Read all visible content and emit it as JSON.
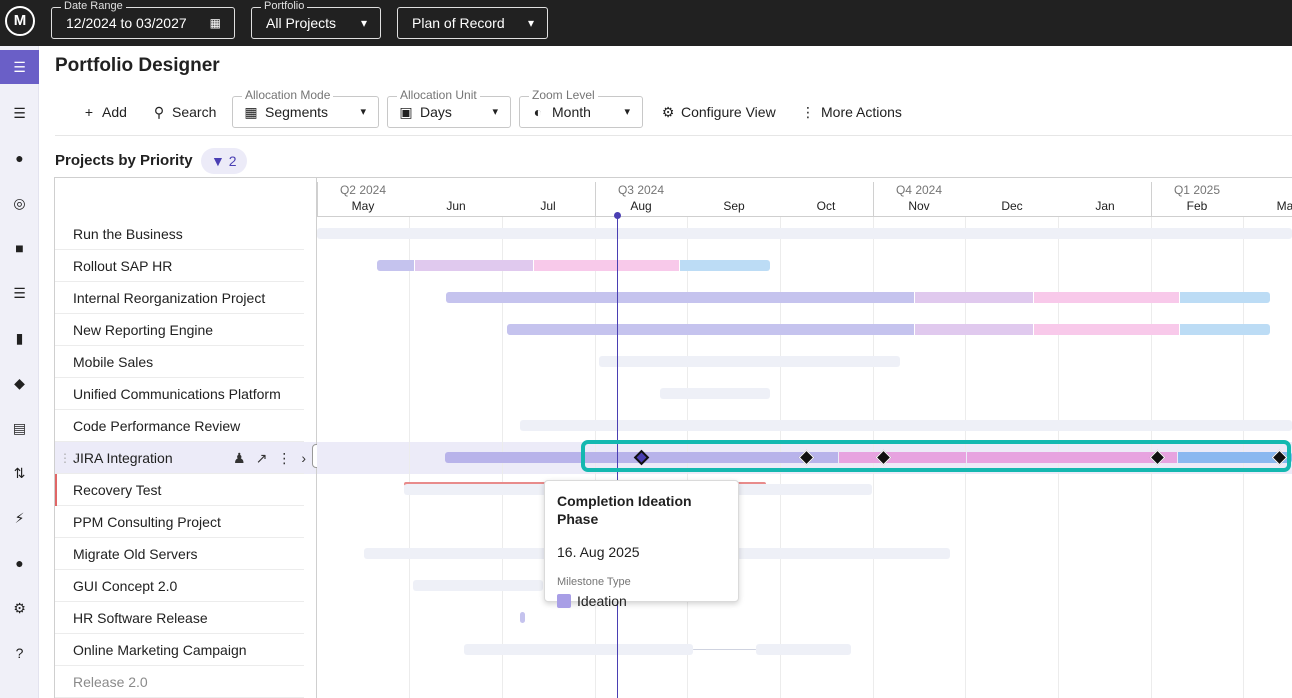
{
  "topbar": {
    "logo": "M",
    "date_range": {
      "legend": "Date Range",
      "value": "12/2024 to 03/2027",
      "icon": "calendar-icon"
    },
    "portfolio": {
      "legend": "Portfolio",
      "value": "All Projects"
    },
    "scenario": {
      "value": "Plan of Record"
    }
  },
  "sidebar": {
    "items": [
      "menu-icon",
      "resources-icon",
      "portfolio-icon",
      "goals-icon",
      "tasks-icon",
      "list-icon",
      "board-icon",
      "roadmap-icon",
      "document-icon",
      "transfer-icon",
      "plugin-icon",
      "users-icon",
      "settings-icon",
      "help-icon"
    ]
  },
  "page": {
    "title": "Portfolio Designer"
  },
  "toolbar": {
    "add": "Add",
    "search": "Search",
    "allocation_mode": {
      "legend": "Allocation Mode",
      "value": "Segments"
    },
    "allocation_unit": {
      "legend": "Allocation Unit",
      "value": "Days"
    },
    "zoom_level": {
      "legend": "Zoom Level",
      "value": "Month"
    },
    "configure_view": "Configure View",
    "more_actions": "More Actions"
  },
  "section": {
    "title": "Projects by Priority",
    "filter_count": "2"
  },
  "timeline": {
    "quarters": [
      "Q2 2024",
      "Q3 2024",
      "Q4 2024",
      "Q1 2025"
    ],
    "months": [
      "May",
      "Jun",
      "Jul",
      "Aug",
      "Sep",
      "Oct",
      "Nov",
      "Dec",
      "Jan",
      "Feb",
      "Ma"
    ]
  },
  "projects": [
    {
      "name": "Run the Business"
    },
    {
      "name": "Rollout SAP HR"
    },
    {
      "name": "Internal Reorganization Project"
    },
    {
      "name": "New Reporting Engine"
    },
    {
      "name": "Mobile Sales"
    },
    {
      "name": "Unified Communications Platform"
    },
    {
      "name": "Code Performance Review"
    },
    {
      "name": "JIRA Integration"
    },
    {
      "name": "Recovery Test"
    },
    {
      "name": "PPM Consulting Project"
    },
    {
      "name": "Migrate Old Servers"
    },
    {
      "name": "GUI Concept 2.0"
    },
    {
      "name": "HR Software Release"
    },
    {
      "name": "Online Marketing Campaign"
    },
    {
      "name": "Release 2.0"
    }
  ],
  "tooltip": {
    "title": "Completion Ideation Phase",
    "date": "16. Aug 2025",
    "type_label": "Milestone Type",
    "type_value": "Ideation"
  },
  "colors": {
    "accent": "#4a3fb3",
    "highlight": "#14b8b0",
    "ideation": "#a89ee6",
    "pink": "#f4b8e0",
    "blue": "#9cc8f0"
  }
}
